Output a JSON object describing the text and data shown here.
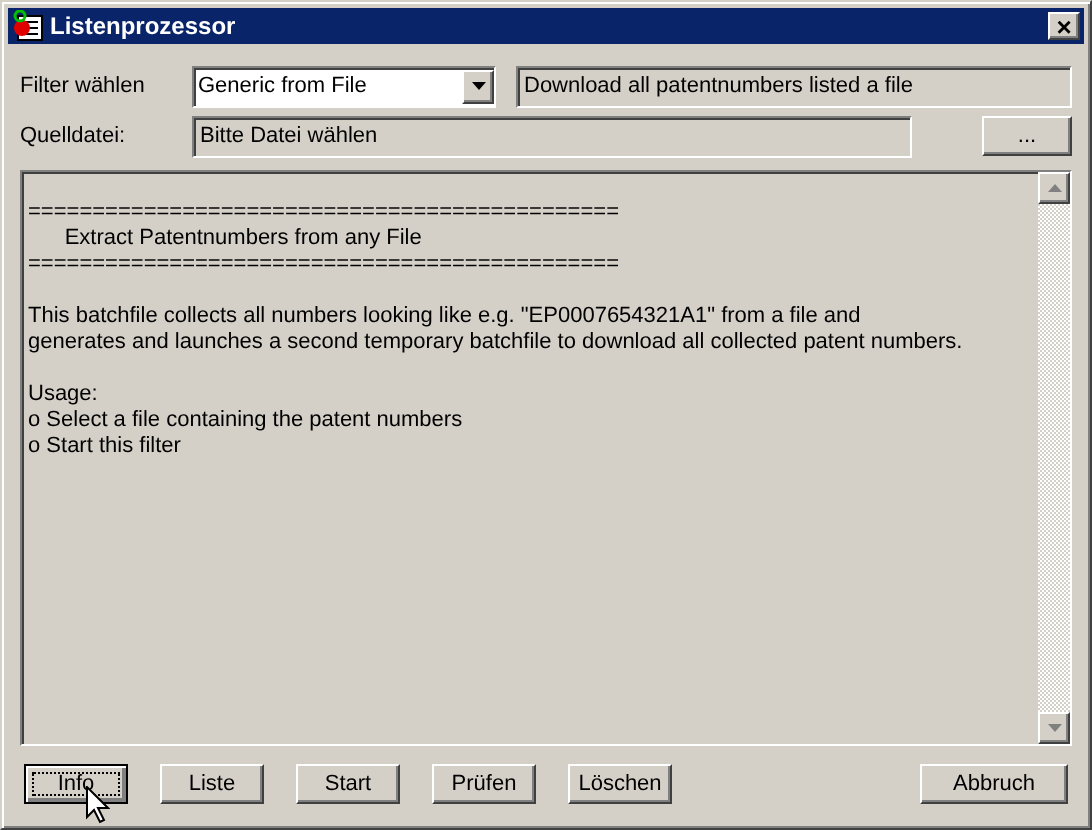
{
  "window": {
    "title": "Listenprozessor",
    "close": "×"
  },
  "filter": {
    "label": "Filter wählen",
    "value": "Generic from File",
    "description": "Download all patentnumbers listed a file"
  },
  "source": {
    "label": "Quelldatei:",
    "value": "Bitte Datei wählen",
    "browse": "..."
  },
  "text_blocks": [
    [
      "==============================================",
      "      Extract Patentnumbers from any File",
      "=============================================="
    ],
    [
      "This batchfile collects all numbers looking like e.g. \"EP0007654321A1\" from a file and",
      "generates and launches a second temporary batchfile to download all collected patent numbers."
    ],
    [
      "Usage:",
      "o Select a file containing the patent numbers",
      "o Start this filter"
    ]
  ],
  "buttons": [
    {
      "label": "Info",
      "focused": true
    },
    {
      "label": "Liste",
      "focused": false
    },
    {
      "label": "Start",
      "focused": false
    },
    {
      "label": "Prüfen",
      "focused": false
    },
    {
      "label": "Löschen",
      "focused": false
    },
    {
      "label": "Abbruch",
      "focused": false
    }
  ]
}
